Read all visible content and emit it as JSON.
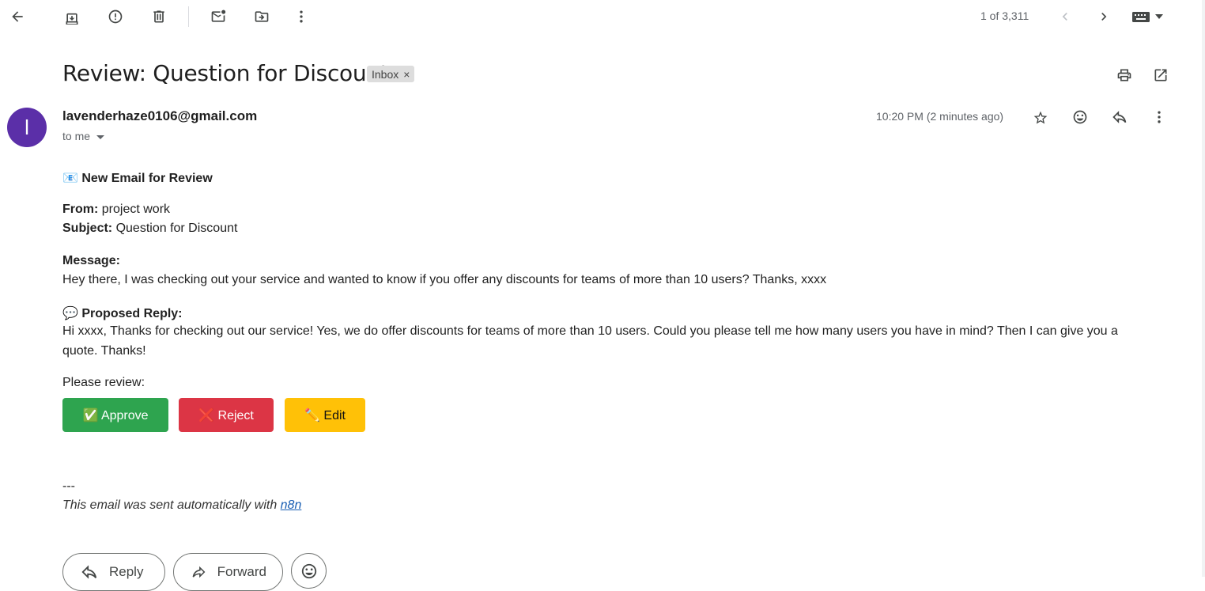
{
  "toolbar": {
    "back_icon": "arrow-left-icon",
    "icons": [
      "archive-icon",
      "report-spam-icon",
      "delete-icon",
      "mark-unread-icon",
      "move-to-icon",
      "more-vert-icon"
    ],
    "counter": "1 of 3,311"
  },
  "email": {
    "subject": "Review: Question for Discount",
    "label": "Inbox",
    "label_close": "×",
    "avatar_letter": "l",
    "avatar_color": "#5b2fa8",
    "sender": "lavenderhaze0106@gmail.com",
    "to": "to me",
    "time": "10:20 PM (2 minutes ago)"
  },
  "body": {
    "heading_emoji": "📧",
    "heading": "New Email for Review",
    "from_label": "From:",
    "from_value": "project work",
    "subject_label": "Subject:",
    "subject_value": "Question for Discount",
    "message_label": "Message:",
    "message": "Hey there, I was checking out your service and wanted to know if you offer any discounts for teams of more than 10 users? Thanks, xxxx",
    "reply_emoji": "💬",
    "reply_label": "Proposed Reply:",
    "reply_line1": "Hi xxxx, Thanks for checking out our service! Yes, we do offer discounts for teams of more than 10 users. Could you please tell me how many users you have in mind? Then I can give you a",
    "reply_line2": "quote. Thanks!",
    "review_prompt": "Please review:",
    "approve": "✅ Approve",
    "reject": "❌ Reject",
    "edit": "✏️ Edit",
    "separator": "---",
    "footer_text": "This email was sent automatically with ",
    "footer_link": "n8n"
  },
  "actions": {
    "reply": "Reply",
    "forward": "Forward"
  },
  "colors": {
    "approve": "#2ea44f",
    "reject": "#dc3545",
    "edit": "#ffc107"
  }
}
